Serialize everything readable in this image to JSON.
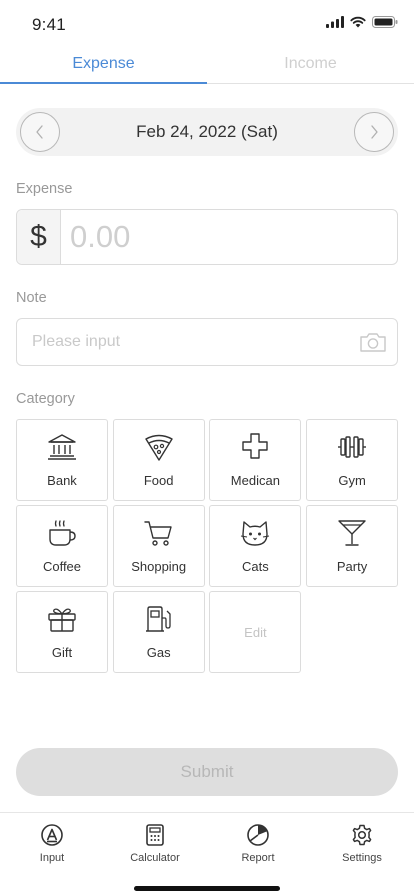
{
  "status_bar": {
    "time": "9:41"
  },
  "tabs": [
    {
      "label": "Expense",
      "active": true
    },
    {
      "label": "Income",
      "active": false
    }
  ],
  "date_nav": {
    "date": "Feb 24, 2022 (Sat)"
  },
  "expense": {
    "label": "Expense",
    "currency": "$",
    "placeholder": "0.00",
    "value": ""
  },
  "note": {
    "label": "Note",
    "placeholder": "Please input",
    "value": ""
  },
  "category": {
    "label": "Category",
    "items": [
      {
        "label": "Bank",
        "icon": "bank-icon"
      },
      {
        "label": "Food",
        "icon": "pizza-icon"
      },
      {
        "label": "Medican",
        "icon": "medical-cross-icon"
      },
      {
        "label": "Gym",
        "icon": "dumbbell-icon"
      },
      {
        "label": "Coffee",
        "icon": "coffee-icon"
      },
      {
        "label": "Shopping",
        "icon": "cart-icon"
      },
      {
        "label": "Cats",
        "icon": "cat-icon"
      },
      {
        "label": "Party",
        "icon": "cocktail-icon"
      },
      {
        "label": "Gift",
        "icon": "gift-icon"
      },
      {
        "label": "Gas",
        "icon": "gas-pump-icon"
      }
    ],
    "edit_label": "Edit"
  },
  "submit_label": "Submit",
  "bottom_nav": [
    {
      "label": "Input",
      "icon": "input-icon"
    },
    {
      "label": "Calculator",
      "icon": "calculator-icon"
    },
    {
      "label": "Report",
      "icon": "pie-chart-icon"
    },
    {
      "label": "Settings",
      "icon": "gear-icon"
    }
  ],
  "colors": {
    "accent": "#4b8ad6",
    "inactive_tab": "#cfcfcf",
    "submit_disabled_bg": "#dedede",
    "submit_disabled_text": "#b7b7b7"
  }
}
